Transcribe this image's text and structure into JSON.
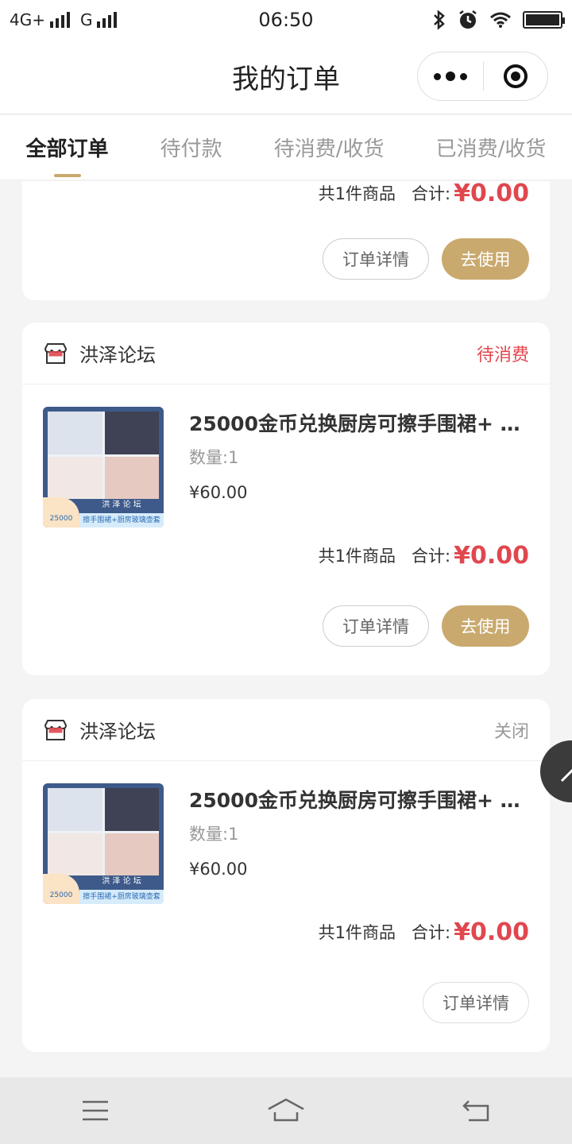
{
  "status_bar": {
    "network1": "4G+",
    "network2": "G",
    "time": "06:50"
  },
  "nav": {
    "title": "我的订单",
    "menu_icon": "more-dots-icon",
    "close_icon": "target-circle-icon"
  },
  "tabs": [
    {
      "label": "全部订单",
      "active": true
    },
    {
      "label": "待付款",
      "active": false
    },
    {
      "label": "待消费/收货",
      "active": false
    },
    {
      "label": "已消费/收货",
      "active": false
    }
  ],
  "orders": [
    {
      "partial": true,
      "total_count": "共1件商品",
      "total_label": "合计:",
      "total_amount": "¥0.00",
      "buttons": [
        "订单详情",
        "去使用"
      ]
    },
    {
      "shop": "洪泽论坛",
      "status": "待消费",
      "item": {
        "name": "25000金币兑换厨房可擦手围裙+ …",
        "qty": "数量:1",
        "price": "¥60.00",
        "thumb_brand": "洪 泽 论 坛",
        "thumb_strip": "擦手围裙+厨房玻璃壶套装",
        "thumb_coin": "25000"
      },
      "total_count": "共1件商品",
      "total_label": "合计:",
      "total_amount": "¥0.00",
      "buttons": [
        "订单详情",
        "去使用"
      ]
    },
    {
      "shop": "洪泽论坛",
      "status": "关闭",
      "item": {
        "name": "25000金币兑换厨房可擦手围裙+ …",
        "qty": "数量:1",
        "price": "¥60.00",
        "thumb_brand": "洪 泽 论 坛",
        "thumb_strip": "擦手围裙+厨房玻璃壶套装",
        "thumb_coin": "25000"
      },
      "total_count": "共1件商品",
      "total_label": "合计:",
      "total_amount": "¥0.00",
      "buttons": [
        "订单详情"
      ]
    }
  ],
  "colors": {
    "accent_gold": "#c9a96e",
    "price_red": "#e0474f"
  },
  "system_nav": [
    "menu-icon",
    "home-icon",
    "back-icon"
  ]
}
